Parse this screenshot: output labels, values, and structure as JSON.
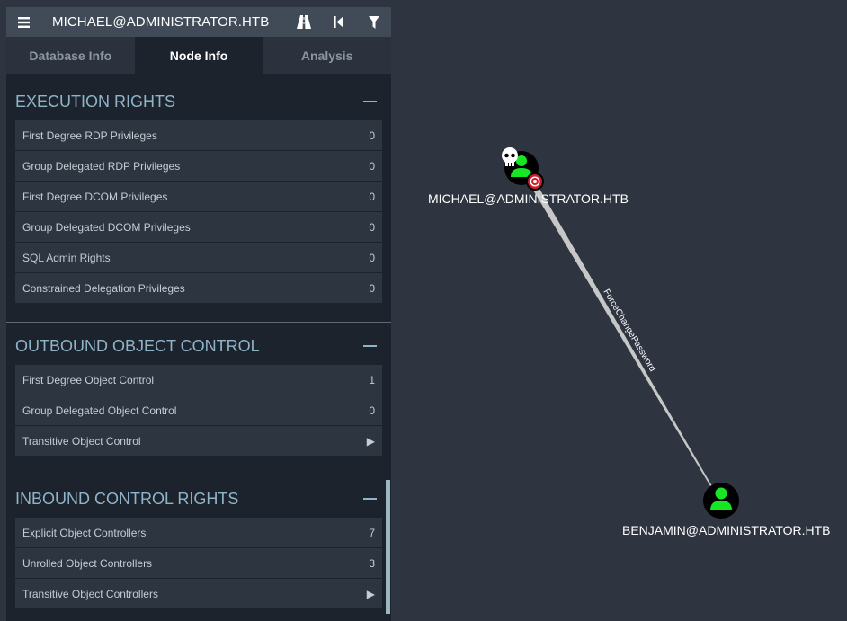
{
  "header": {
    "title": "MICHAEL@ADMINISTRATOR.HTB",
    "icons": [
      "menu-icon",
      "pathfinding-road-icon",
      "back-icon",
      "filter-icon"
    ]
  },
  "tabs": [
    {
      "label": "Database Info",
      "active": false
    },
    {
      "label": "Node Info",
      "active": true
    },
    {
      "label": "Analysis",
      "active": false
    }
  ],
  "sections": {
    "execution": {
      "title": "EXECUTION RIGHTS",
      "rows": [
        {
          "label": "First Degree RDP Privileges",
          "value": "0"
        },
        {
          "label": "Group Delegated RDP Privileges",
          "value": "0"
        },
        {
          "label": "First Degree DCOM Privileges",
          "value": "0"
        },
        {
          "label": "Group Delegated DCOM Privileges",
          "value": "0"
        },
        {
          "label": "SQL Admin Rights",
          "value": "0"
        },
        {
          "label": "Constrained Delegation Privileges",
          "value": "0"
        }
      ]
    },
    "outbound": {
      "title": "OUTBOUND OBJECT CONTROL",
      "rows": [
        {
          "label": "First Degree Object Control",
          "value": "1"
        },
        {
          "label": "Group Delegated Object Control",
          "value": "0"
        },
        {
          "label": "Transitive Object Control",
          "value": "▶"
        }
      ]
    },
    "inbound": {
      "title": "INBOUND CONTROL RIGHTS",
      "rows": [
        {
          "label": "Explicit Object Controllers",
          "value": "7"
        },
        {
          "label": "Unrolled Object Controllers",
          "value": "3"
        },
        {
          "label": "Transitive Object Controllers",
          "value": "▶"
        }
      ]
    }
  },
  "graph": {
    "nodes": [
      {
        "label": "MICHAEL@ADMINISTRATOR.HTB",
        "owned": true,
        "target": true
      },
      {
        "label": "BENJAMIN@ADMINISTRATOR.HTB",
        "owned": false,
        "target": false
      }
    ],
    "edge": {
      "label": "ForceChangePassword"
    },
    "colors": {
      "user_icon": "#17e625",
      "background": "#2f3540",
      "target": "#cc1f2a"
    }
  }
}
